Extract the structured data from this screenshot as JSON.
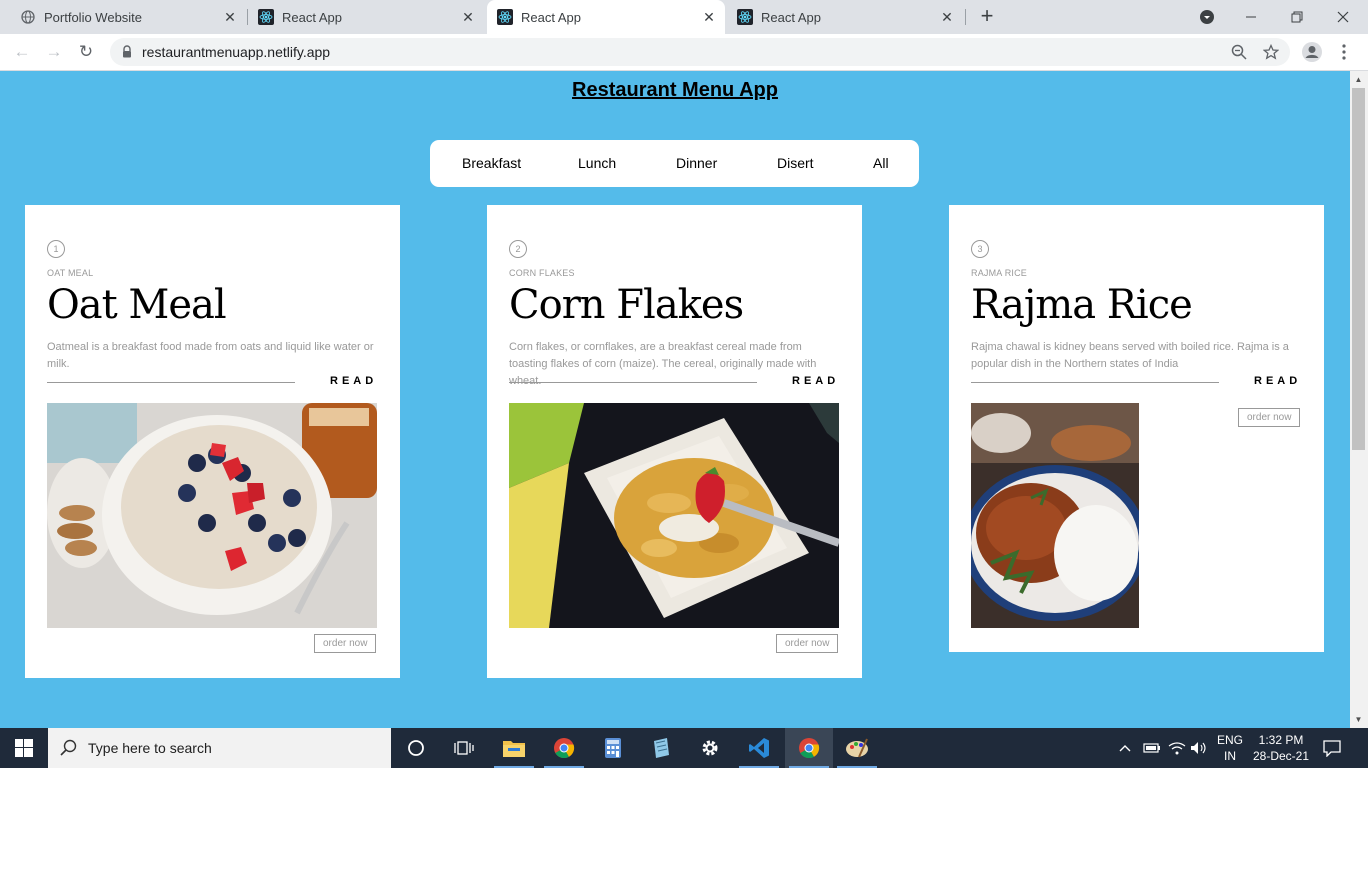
{
  "browser": {
    "tabs": [
      {
        "title": "Portfolio Website",
        "icon": "globe-icon"
      },
      {
        "title": "React App",
        "icon": "react-icon"
      },
      {
        "title": "React App",
        "icon": "react-icon",
        "active": true
      },
      {
        "title": "React App",
        "icon": "react-icon"
      }
    ],
    "url": "restaurantmenuapp.netlify.app"
  },
  "page": {
    "title": "Restaurant Menu App",
    "filters": [
      "Breakfast",
      "Lunch",
      "Dinner",
      "Disert",
      "All"
    ],
    "read_label": "READ",
    "order_label": "order now",
    "items": [
      {
        "num": "1",
        "category": "OAT MEAL",
        "name": "Oat Meal",
        "desc": "Oatmeal is a breakfast food made from oats and liquid like water or milk."
      },
      {
        "num": "2",
        "category": "CORN FLAKES",
        "name": "Corn Flakes",
        "desc": "Corn flakes, or cornflakes, are a breakfast cereal made from toasting flakes of corn (maize). The cereal, originally made with wheat."
      },
      {
        "num": "3",
        "category": "RAJMA RICE",
        "name": "Rajma Rice",
        "desc": "Rajma chawal is kidney beans served with boiled rice. Rajma is a popular dish in the Northern states of India"
      }
    ]
  },
  "taskbar": {
    "search_placeholder": "Type here to search",
    "lang_top": "ENG",
    "lang_bottom": "IN",
    "time": "1:32 PM",
    "date": "28-Dec-21"
  },
  "colors": {
    "page_bg": "#54bbea",
    "taskbar_bg": "#1f2a3a"
  }
}
